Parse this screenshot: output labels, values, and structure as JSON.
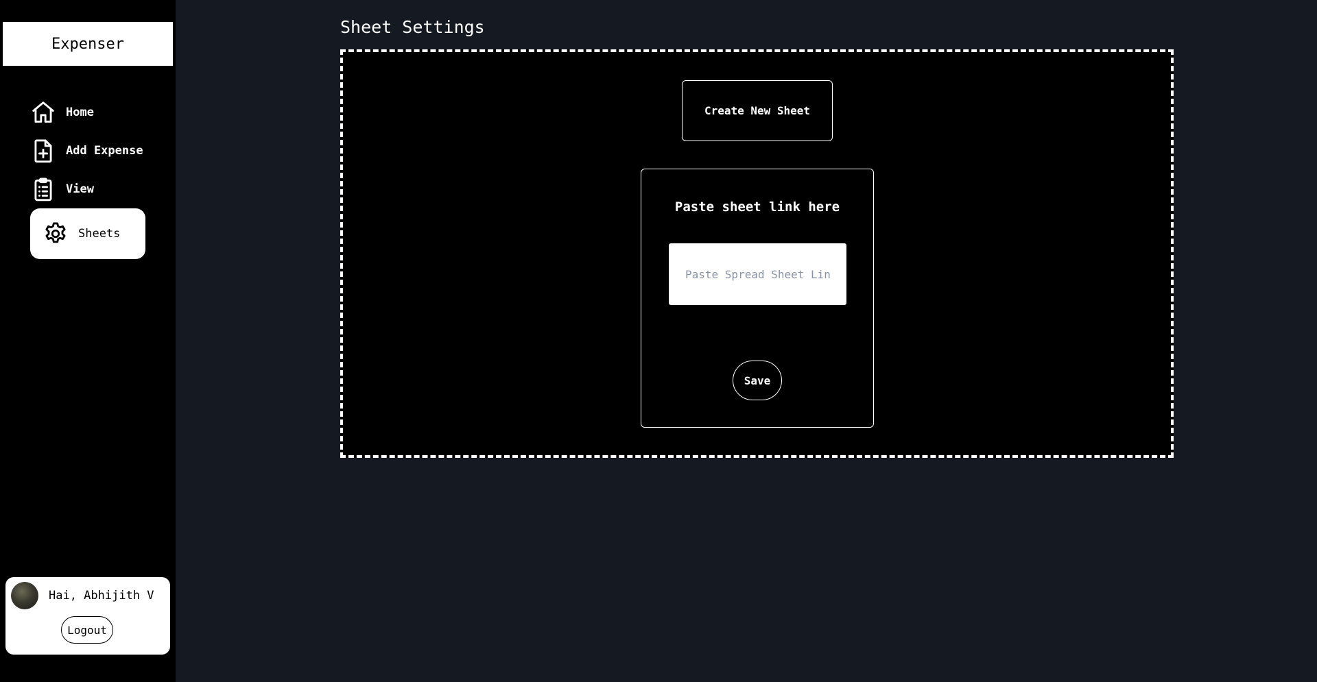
{
  "app": {
    "brand": "Expenser"
  },
  "sidebar": {
    "items": [
      {
        "label": "Home",
        "icon": "home-icon"
      },
      {
        "label": "Add Expense",
        "icon": "file-plus-icon"
      },
      {
        "label": "View",
        "icon": "clipboard-list-icon"
      },
      {
        "label": "Sheets",
        "icon": "gear-icon",
        "active": true
      }
    ]
  },
  "user": {
    "greeting": "Hai, Abhijith V",
    "logout_label": "Logout"
  },
  "main": {
    "title": "Sheet Settings",
    "create_label": "Create New Sheet",
    "link_heading": "Paste sheet link here",
    "link_placeholder": "Paste Spread Sheet Link",
    "link_value": "",
    "save_label": "Save"
  },
  "colors": {
    "page_bg": "#151922",
    "sidebar_bg": "#000000",
    "panel_bg": "#000000",
    "accent": "#ffffff",
    "placeholder": "#8a93a6"
  }
}
